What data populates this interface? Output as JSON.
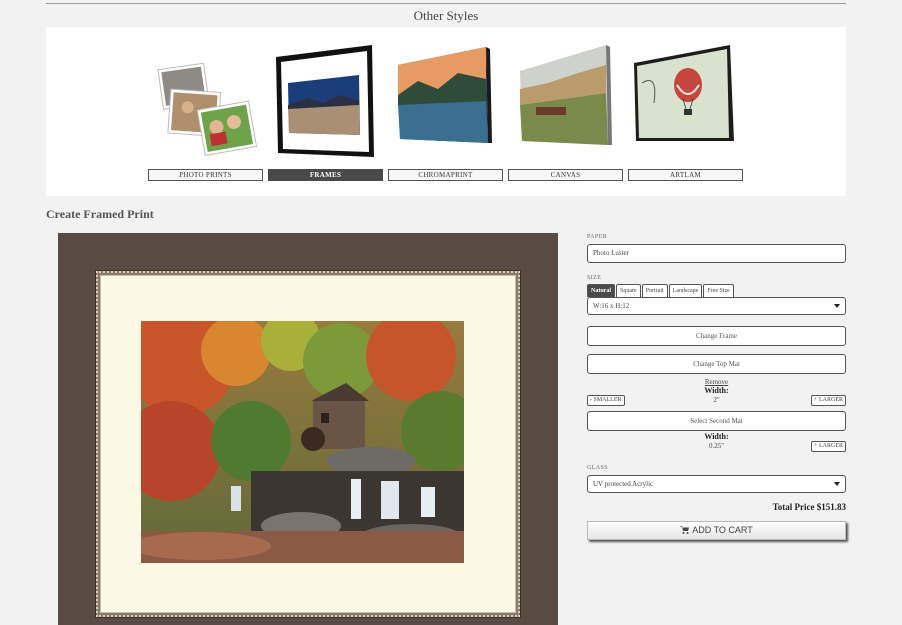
{
  "other_styles": {
    "title": "Other Styles",
    "items": [
      {
        "label": "PHOTO PRINTS",
        "icon": "photo-prints-thumbnail",
        "active": false
      },
      {
        "label": "FRAMES",
        "icon": "frames-thumbnail",
        "active": true
      },
      {
        "label": "CHROMAPRINT",
        "icon": "chromaprint-thumbnail",
        "active": false
      },
      {
        "label": "CANVAS",
        "icon": "canvas-thumbnail",
        "active": false
      },
      {
        "label": "ARTLAM",
        "icon": "artlam-thumbnail",
        "active": false
      }
    ]
  },
  "create": {
    "title": "Create Framed Print"
  },
  "form": {
    "paper_label": "PAPER",
    "paper_value": "Photo Luster",
    "size_label": "SIZE",
    "size_tabs": [
      "Natural",
      "Square",
      "Portrait",
      "Landscape",
      "Free Size"
    ],
    "size_active": "Natural",
    "size_value": "W:16 x H:12",
    "change_frame": "Change Frame",
    "change_top_mat": "Change Top Mat",
    "remove": "Remove",
    "width_label": "Width:",
    "top_mat_width": "2\"",
    "smaller": "- SMALLER",
    "larger": "+ LARGER",
    "select_second_mat": "Select Second Mat",
    "second_width_label": "Width:",
    "second_mat_width": "0.25\"",
    "second_larger": "+ LARGER",
    "glass_label": "GLASS",
    "glass_value": "UV protected Acrylic",
    "total": "Total Price $151.83",
    "add_to_cart": "ADD TO CART",
    "cart_icon": "cart-icon"
  },
  "colors": {
    "active_tab": "#4a4a4a",
    "frame_wood": "#574b44",
    "mat": "#fbf9e6"
  }
}
